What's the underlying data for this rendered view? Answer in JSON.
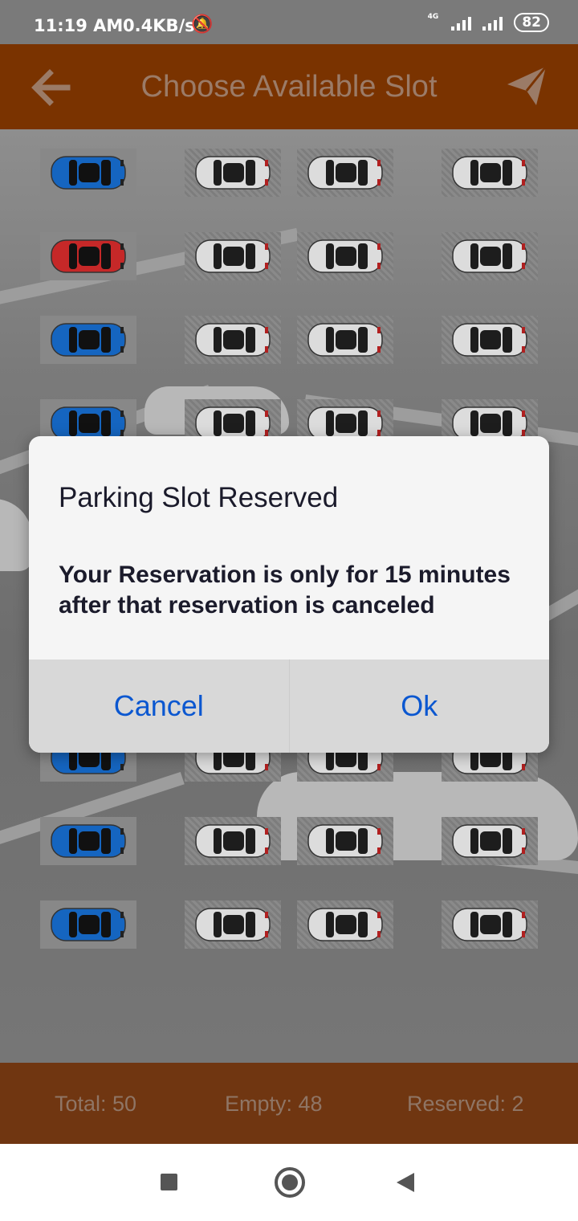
{
  "status_bar": {
    "time": "11:19 AM",
    "speed": "0.4KB/s",
    "mute_icon": "bell-off-icon",
    "network_label": "4G",
    "battery": "82"
  },
  "app_bar": {
    "title": "Choose Available Slot",
    "back_icon": "arrow-left-icon",
    "action_icon": "send-icon",
    "color": "#7a3300"
  },
  "parking": {
    "rows": [
      [
        "blue",
        "grey",
        "grey",
        "grey"
      ],
      [
        "red",
        "grey",
        "grey",
        "grey"
      ],
      [
        "blue",
        "grey",
        "grey",
        "grey"
      ],
      [
        "blue",
        "grey",
        "grey",
        "grey"
      ],
      [
        "blue",
        "grey",
        "grey",
        "grey"
      ],
      [
        "blue",
        "grey",
        "grey",
        "grey"
      ],
      [
        "blue",
        "grey",
        "grey",
        "grey"
      ],
      [
        "blue",
        "grey",
        "grey",
        "grey"
      ],
      [
        "blue",
        "grey",
        "grey",
        "grey"
      ],
      [
        "blue",
        "grey",
        "grey",
        "grey"
      ]
    ],
    "colors": {
      "blue": "#1565c0",
      "red": "#c62828",
      "grey": "#dcdcdc"
    }
  },
  "footer": {
    "total": "Total: 50",
    "empty": "Empty: 48",
    "reserved": "Reserved: 2"
  },
  "dialog": {
    "title": "Parking Slot Reserved",
    "message": "Your Reservation is only for 15 minutes after that reservation is canceled",
    "cancel_label": "Cancel",
    "ok_label": "Ok"
  },
  "nav": {
    "recents_icon": "square-icon",
    "home_icon": "circle-icon",
    "back_icon": "triangle-back-icon"
  }
}
